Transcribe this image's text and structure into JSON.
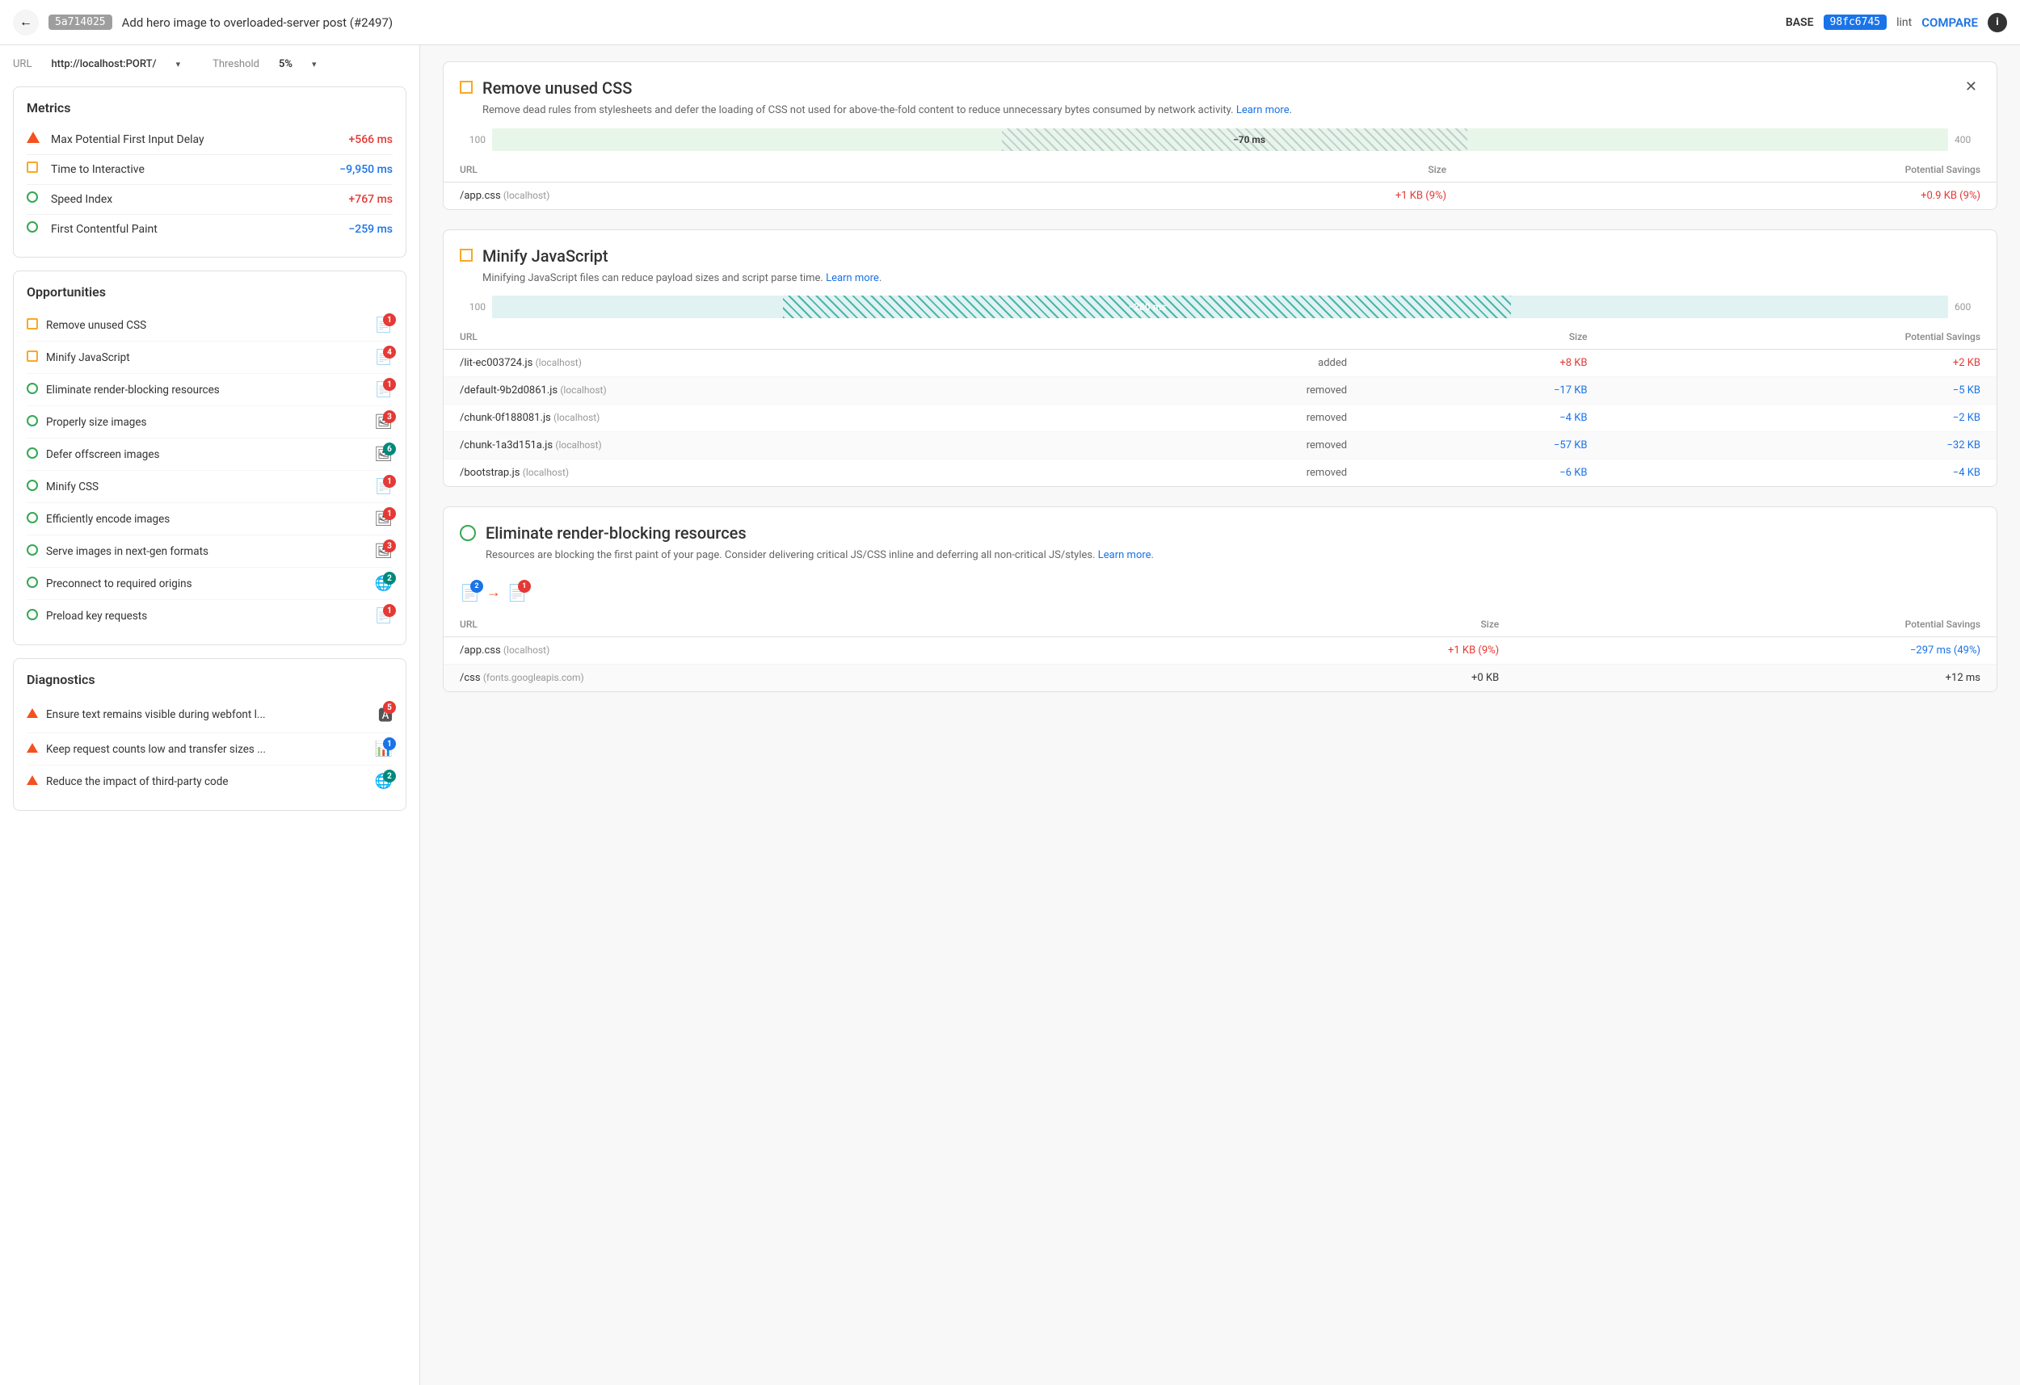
{
  "header": {
    "back_label": "←",
    "commit1": "5a714025",
    "commit_title": "Add hero image to overloaded-server post (#2497)",
    "base_label": "BASE",
    "commit2": "98fc6745",
    "lint_label": "lint",
    "compare_label": "COMPARE",
    "info_label": "i"
  },
  "url_row": {
    "url_label": "URL",
    "url_value": "http://localhost:PORT/",
    "threshold_label": "Threshold",
    "threshold_value": "5%"
  },
  "metrics": {
    "title": "Metrics",
    "items": [
      {
        "icon": "triangle",
        "name": "Max Potential First Input Delay",
        "value": "+566 ms",
        "color": "red"
      },
      {
        "icon": "square-orange",
        "name": "Time to Interactive",
        "value": "−9,950 ms",
        "color": "blue"
      },
      {
        "icon": "circle-green",
        "name": "Speed Index",
        "value": "+767 ms",
        "color": "red"
      },
      {
        "icon": "circle-green",
        "name": "First Contentful Paint",
        "value": "−259 ms",
        "color": "neg-blue"
      }
    ]
  },
  "opportunities": {
    "title": "Opportunities",
    "items": [
      {
        "icon": "square-orange",
        "name": "Remove unused CSS",
        "badge": "1",
        "badge_color": "red"
      },
      {
        "icon": "square-orange",
        "name": "Minify JavaScript",
        "badge": "4",
        "badge_color": "red"
      },
      {
        "icon": "circle-green",
        "name": "Eliminate render-blocking resources",
        "badge": "1",
        "badge_color": "red"
      },
      {
        "icon": "circle-green",
        "name": "Properly size images",
        "badge": "3",
        "badge_color": "red"
      },
      {
        "icon": "circle-green",
        "name": "Defer offscreen images",
        "badge": "6",
        "badge_color": "teal"
      },
      {
        "icon": "circle-green",
        "name": "Minify CSS",
        "badge": "1",
        "badge_color": "red"
      },
      {
        "icon": "circle-green",
        "name": "Efficiently encode images",
        "badge": "1",
        "badge_color": "red"
      },
      {
        "icon": "circle-green",
        "name": "Serve images in next-gen formats",
        "badge": "3",
        "badge_color": "red"
      },
      {
        "icon": "circle-green",
        "name": "Preconnect to required origins",
        "badge": "2",
        "badge_color": "teal"
      },
      {
        "icon": "circle-green",
        "name": "Preload key requests",
        "badge": "1",
        "badge_color": "red"
      }
    ]
  },
  "diagnostics": {
    "title": "Diagnostics",
    "items": [
      {
        "icon": "triangle",
        "name": "Ensure text remains visible during webfont l...",
        "badge": "5",
        "badge_color": "red"
      },
      {
        "icon": "triangle",
        "name": "Keep request counts low and transfer sizes ...",
        "badge": "1",
        "badge_color": "blue"
      },
      {
        "icon": "triangle",
        "name": "Reduce the impact of third-party code",
        "badge": "2",
        "badge_color": "teal"
      }
    ]
  },
  "detail_cards": {
    "remove_unused_css": {
      "title": "Remove unused CSS",
      "description": "Remove dead rules from stylesheets and defer the loading of CSS not used for above-the-fold content to reduce unnecessary bytes consumed by network activity.",
      "learn_more": "Learn more",
      "chart": {
        "start": "100",
        "end": "400",
        "value_label": "−70 ms",
        "bar_offset_pct": "35",
        "bar_width_pct": "35"
      },
      "table": {
        "headers": [
          "URL",
          "Size",
          "Potential Savings"
        ],
        "rows": [
          {
            "url": "/app.css",
            "host": "(localhost)",
            "status": "",
            "size": "+1 KB (9%)",
            "savings": "+0.9 KB (9%)",
            "size_color": "red",
            "savings_color": "red"
          }
        ]
      }
    },
    "minify_javascript": {
      "title": "Minify JavaScript",
      "description": "Minifying JavaScript files can reduce payload sizes and script parse time.",
      "learn_more": "Learn more",
      "chart": {
        "start": "100",
        "end": "600",
        "value_label": "−280 ms",
        "bar_offset_pct": "20",
        "bar_width_pct": "50"
      },
      "table": {
        "headers": [
          "URL",
          "",
          "Size",
          "Potential Savings"
        ],
        "rows": [
          {
            "url": "/lit-ec003724.js",
            "host": "(localhost)",
            "status": "added",
            "size": "+8 KB",
            "savings": "+2 KB",
            "size_color": "red",
            "savings_color": "red"
          },
          {
            "url": "/default-9b2d0861.js",
            "host": "(localhost)",
            "status": "removed",
            "size": "−17 KB",
            "savings": "−5 KB",
            "size_color": "blue",
            "savings_color": "blue"
          },
          {
            "url": "/chunk-0f188081.js",
            "host": "(localhost)",
            "status": "removed",
            "size": "−4 KB",
            "savings": "−2 KB",
            "size_color": "blue",
            "savings_color": "blue"
          },
          {
            "url": "/chunk-1a3d151a.js",
            "host": "(localhost)",
            "status": "removed",
            "size": "−57 KB",
            "savings": "−32 KB",
            "size_color": "blue",
            "savings_color": "blue"
          },
          {
            "url": "/bootstrap.js",
            "host": "(localhost)",
            "status": "removed",
            "size": "−6 KB",
            "savings": "−4 KB",
            "size_color": "blue",
            "savings_color": "blue"
          }
        ]
      }
    },
    "eliminate_render_blocking": {
      "title": "Eliminate render-blocking resources",
      "description": "Resources are blocking the first paint of your page. Consider delivering critical JS/CSS inline and deferring all non-critical JS/styles.",
      "learn_more": "Learn more",
      "table": {
        "headers": [
          "URL",
          "Size",
          "Potential Savings"
        ],
        "rows": [
          {
            "url": "/app.css",
            "host": "(localhost)",
            "status": "",
            "size": "+1 KB (9%)",
            "savings": "−297 ms (49%)",
            "size_color": "red",
            "savings_color": "blue"
          },
          {
            "url": "/css",
            "host": "(fonts.googleapis.com)",
            "status": "",
            "size": "+0 KB",
            "savings": "+12 ms",
            "size_color": "",
            "savings_color": ""
          }
        ]
      }
    }
  }
}
